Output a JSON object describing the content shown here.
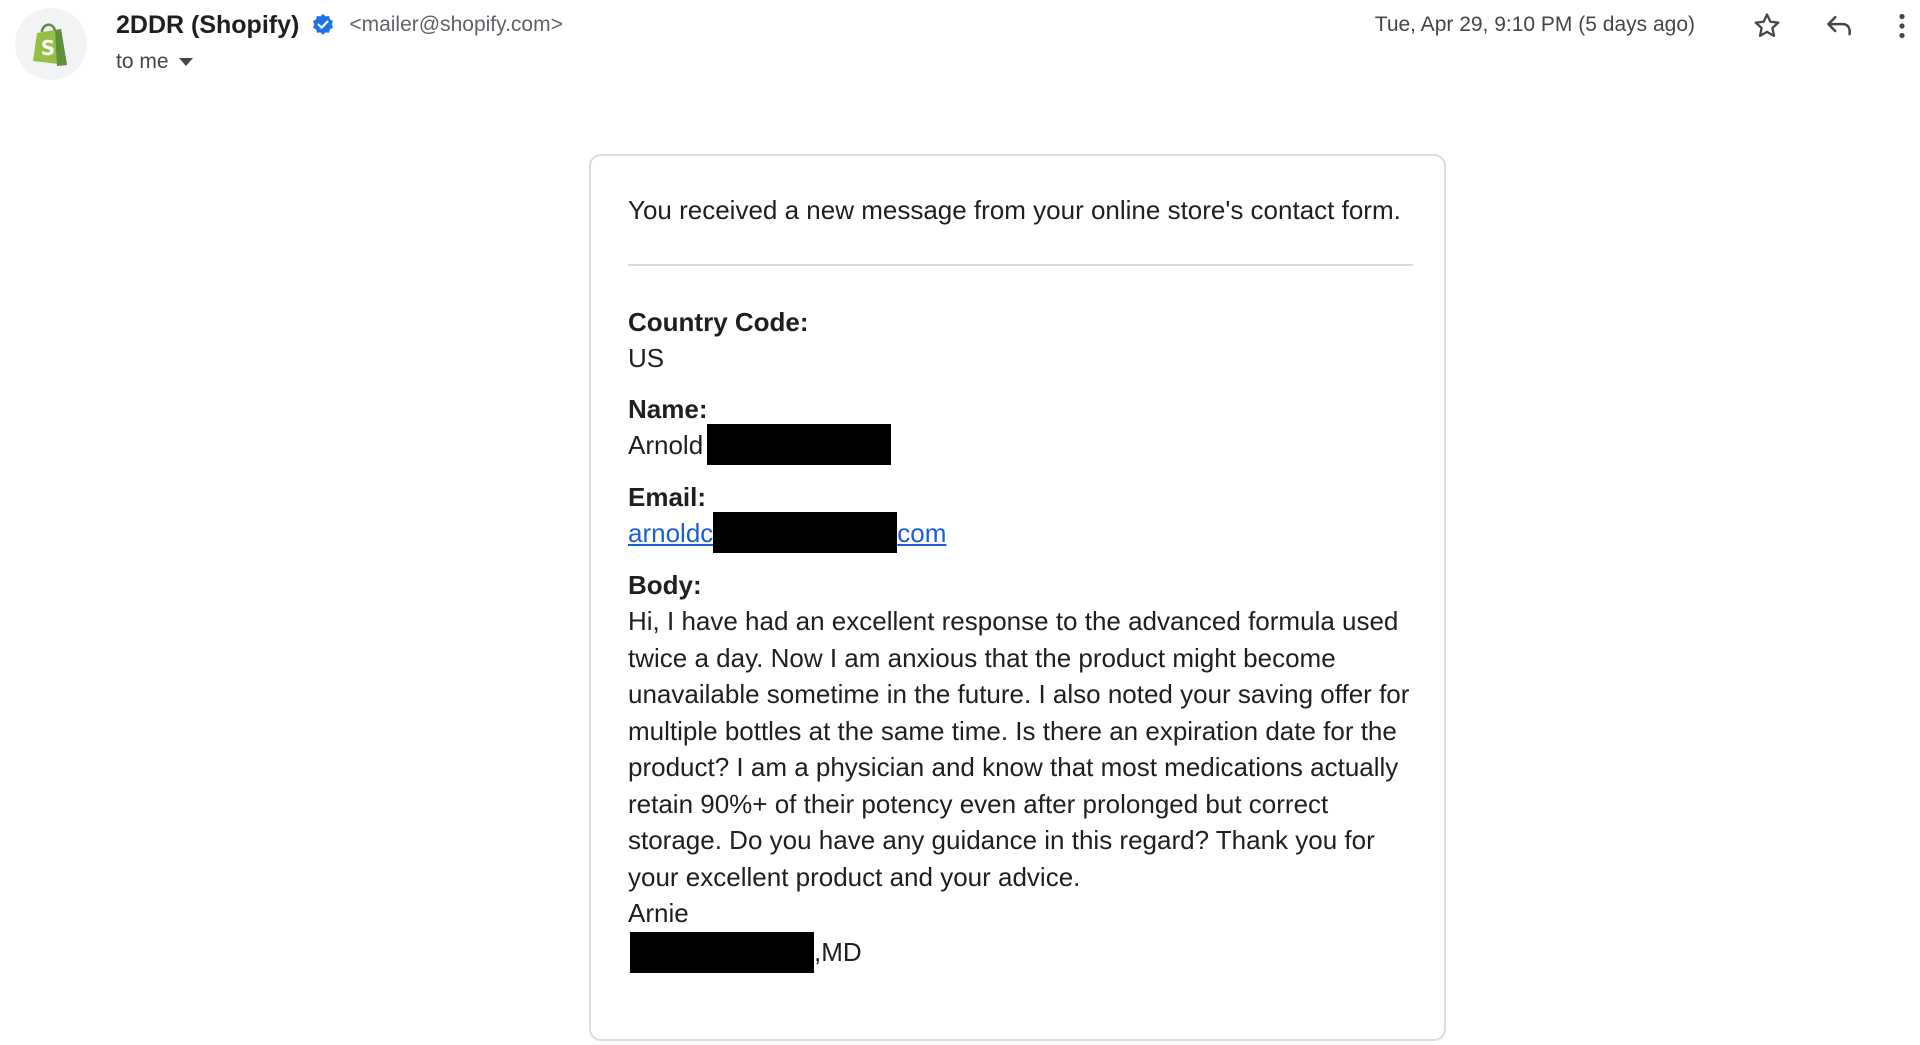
{
  "sender": {
    "name": "2DDR (Shopify)",
    "email": "<mailer@shopify.com>",
    "recipient_label": "to me"
  },
  "header": {
    "date": "Tue, Apr 29, 9:10 PM (5 days ago)",
    "icons": [
      "shopify-logo-icon",
      "verified-icon",
      "chevron-down-icon",
      "star-icon",
      "reply-icon",
      "more-vertical-icon"
    ]
  },
  "message": {
    "intro": "You received a new message from your online store's contact form.",
    "fields": {
      "country_code_label": "Country Code:",
      "country_code_value": "US",
      "name_label": "Name:",
      "name_value": "Arnold",
      "email_label": "Email:",
      "email_prefix": "arnoldc",
      "email_suffix": "com",
      "body_label": "Body:",
      "body_value": "Hi, I have had an excellent response to the advanced formula used twice a day. Now I am anxious that the product might become unavailable sometime in the future. I also noted your saving offer for multiple bottles at the same time. Is there an expiration date for the product? I am a physician and know that most medications actually retain 90%+ of their potency even after prolonged but correct storage. Do you have any guidance in this regard? Thank you for your excellent product and your advice.",
      "signoff": "Arnie",
      "credential": ",MD"
    }
  },
  "colors": {
    "link": "#1a5fd6",
    "verified": "#1a73e8",
    "shopify_green": "#95bf47",
    "redaction": "#000000"
  }
}
